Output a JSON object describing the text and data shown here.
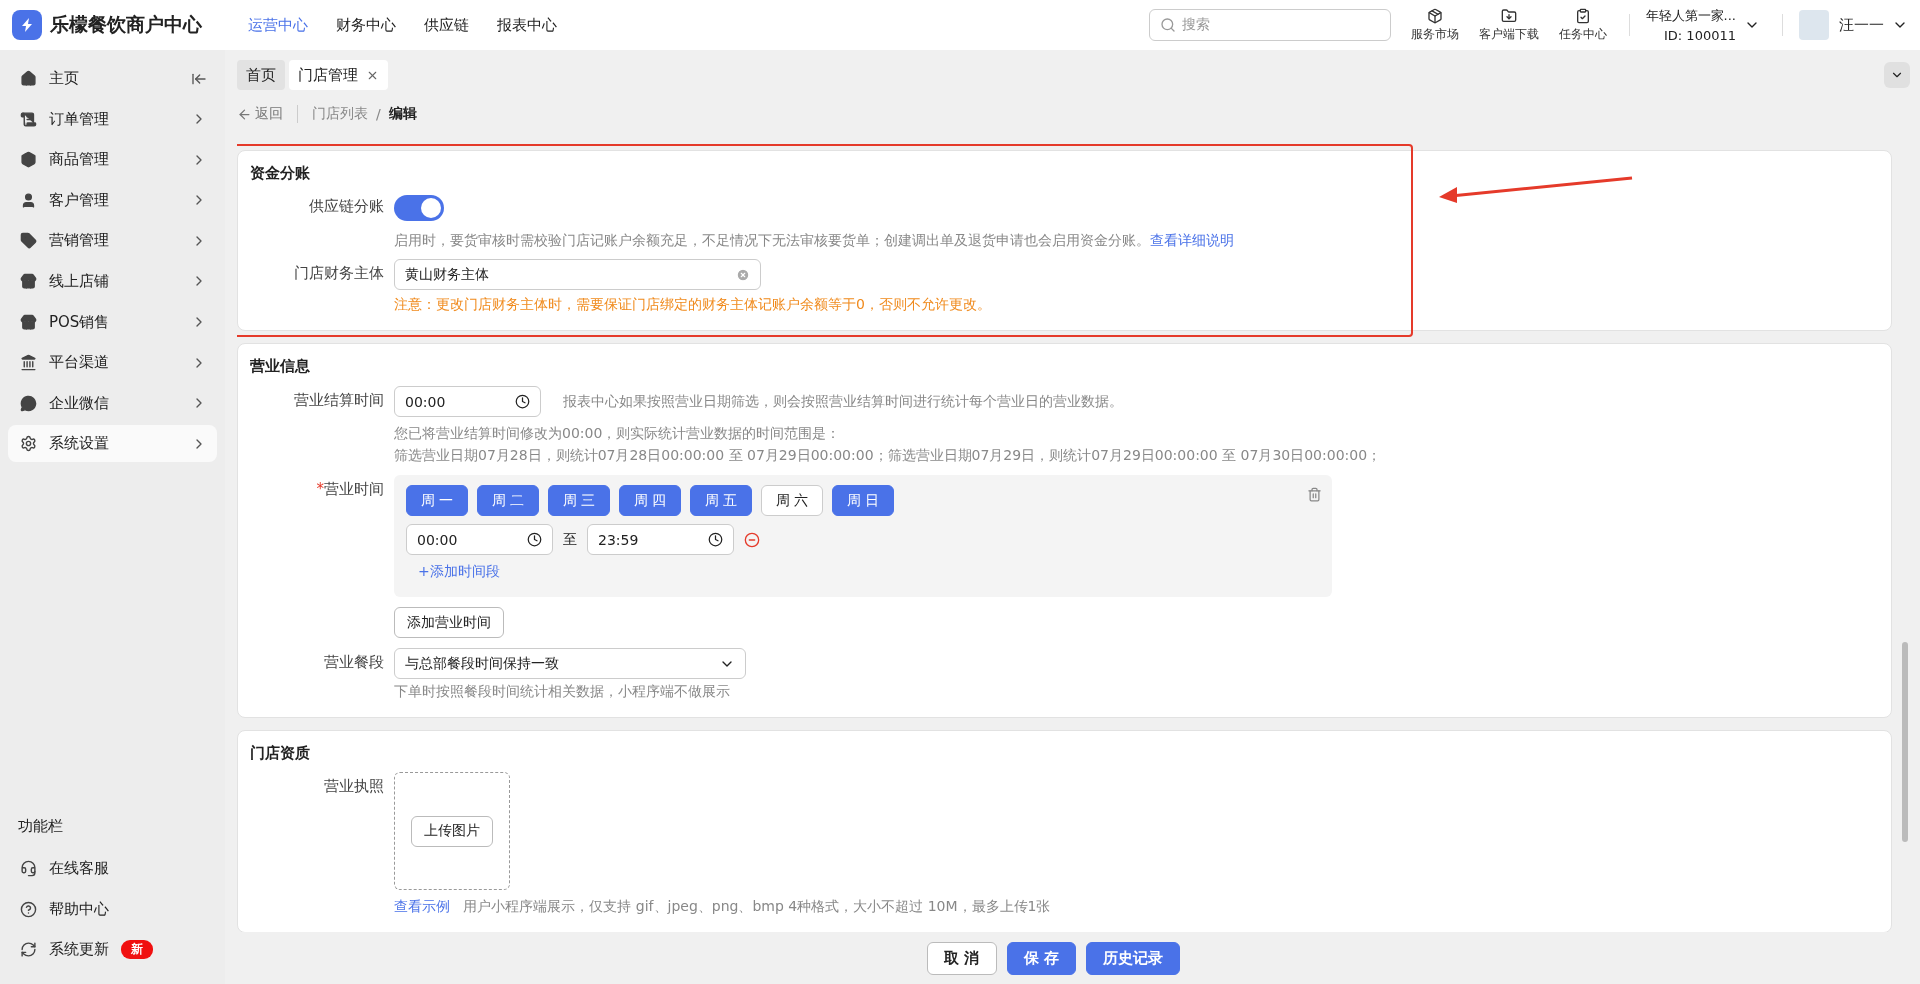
{
  "app": {
    "name": "乐檬餐饮商户中心"
  },
  "top_nav": [
    {
      "label": "运营中心",
      "selected": true
    },
    {
      "label": "财务中心",
      "selected": false
    },
    {
      "label": "供应链",
      "selected": false
    },
    {
      "label": "报表中心",
      "selected": false
    }
  ],
  "search": {
    "placeholder": "搜索"
  },
  "tools": [
    {
      "label": "服务市场"
    },
    {
      "label": "客户端下载"
    },
    {
      "label": "任务中心"
    }
  ],
  "account": {
    "name": "年轻人第一家...",
    "id": "ID: 100011"
  },
  "user": {
    "name": "汪一一"
  },
  "sidebar": {
    "items": [
      {
        "label": "主页",
        "selected": false
      },
      {
        "label": "订单管理",
        "selected": false
      },
      {
        "label": "商品管理",
        "selected": false
      },
      {
        "label": "客户管理",
        "selected": false
      },
      {
        "label": "营销管理",
        "selected": false
      },
      {
        "label": "线上店铺",
        "selected": false
      },
      {
        "label": "POS销售",
        "selected": false
      },
      {
        "label": "平台渠道",
        "selected": false
      },
      {
        "label": "企业微信",
        "selected": false
      },
      {
        "label": "系统设置",
        "selected": true
      }
    ],
    "footer_title": "功能栏",
    "footer_items": [
      {
        "label": "在线客服"
      },
      {
        "label": "帮助中心"
      },
      {
        "label": "系统更新",
        "badge": "新"
      }
    ]
  },
  "tabs": [
    {
      "label": "首页",
      "selected": false,
      "closable": false
    },
    {
      "label": "门店管理",
      "selected": true,
      "closable": true
    }
  ],
  "breadcrumb": {
    "back": "返回",
    "separator": "/",
    "items": [
      "门店列表",
      "编辑"
    ]
  },
  "fund_split": {
    "title": "资金分账",
    "switch_label": "供应链分账",
    "switch_on": true,
    "hint": "启用时，要货审核时需校验门店记账户余额充足，不足情况下无法审核要货单；创建调出单及退货申请也会启用资金分账。",
    "hint_link": "查看详细说明",
    "entity_label": "门店财务主体",
    "entity_value": "黄山财务主体",
    "entity_warning": "注意：更改门店财务主体时，需要保证门店绑定的财务主体记账户余额等于0，否则不允许更改。"
  },
  "business": {
    "title": "营业信息",
    "settle_label": "营业结算时间",
    "settle_value": "00:00",
    "settle_hint": "报表中心如果按照营业日期筛选，则会按照营业结算时间进行统计每个营业日的营业数据。",
    "range_notes": [
      "您已将营业结算时间修改为00:00，则实际统计营业数据的时间范围是：",
      "筛选营业日期07月28日，则统计07月28日00:00:00 至 07月29日00:00:00；筛选营业日期07月29日，则统计07月29日00:00:00 至 07月30日00:00:00；"
    ],
    "required_mark": "*",
    "hours_label": "营业时间",
    "days": [
      {
        "label": "周 一",
        "selected": true
      },
      {
        "label": "周 二",
        "selected": true
      },
      {
        "label": "周 三",
        "selected": true
      },
      {
        "label": "周 四",
        "selected": true
      },
      {
        "label": "周 五",
        "selected": true
      },
      {
        "label": "周 六",
        "selected": false
      },
      {
        "label": "周 日",
        "selected": true
      }
    ],
    "slot": {
      "start": "00:00",
      "sep": "至",
      "end": "23:59"
    },
    "add_slot": "+添加时间段",
    "add_hours": "添加营业时间",
    "meal_label": "营业餐段",
    "meal_value": "与总部餐段时间保持一致",
    "meal_hint": "下单时按照餐段时间统计相关数据，小程序端不做展示"
  },
  "qualification": {
    "title": "门店资质",
    "license_label": "营业执照",
    "upload": "上传图片",
    "example_link": "查看示例",
    "hint": "用户小程序端展示，仅支持 gif、jpeg、png、bmp 4种格式，大小不超过 10M，最多上传1张"
  },
  "footer_buttons": [
    {
      "label": "取 消",
      "kind": "default"
    },
    {
      "label": "保 存",
      "kind": "primary"
    },
    {
      "label": "历史记录",
      "kind": "primary"
    }
  ]
}
